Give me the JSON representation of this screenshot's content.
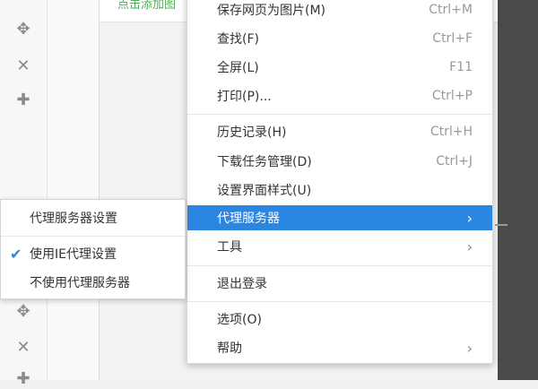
{
  "background_text": "点击添加图",
  "rail_icons_top": [
    "move-icon",
    "close-icon",
    "plus-icon"
  ],
  "rail_icons_bottom": [
    "move-icon",
    "close-icon",
    "plus-icon"
  ],
  "menu": {
    "items": [
      {
        "label": "保存网页为图片(M)",
        "shortcut": "Ctrl+M"
      },
      {
        "label": "查找(F)",
        "shortcut": "Ctrl+F"
      },
      {
        "label": "全屏(L)",
        "shortcut": "F11"
      },
      {
        "label": "打印(P)...",
        "shortcut": "Ctrl+P"
      },
      {
        "label": "历史记录(H)",
        "shortcut": "Ctrl+H"
      },
      {
        "label": "下载任务管理(D)",
        "shortcut": "Ctrl+J"
      },
      {
        "label": "设置界面样式(U)",
        "shortcut": ""
      },
      {
        "label": "代理服务器",
        "shortcut": "",
        "submenu": true,
        "active": true
      },
      {
        "label": "工具",
        "shortcut": "",
        "submenu": true
      },
      {
        "label": "退出登录",
        "shortcut": ""
      },
      {
        "label": "选项(O)",
        "shortcut": ""
      },
      {
        "label": "帮助",
        "shortcut": "",
        "submenu": true
      }
    ],
    "accent_color": "#2b86e2"
  },
  "proxy_submenu": {
    "items": [
      {
        "label": "代理服务器设置",
        "checked": false
      },
      {
        "label": "使用IE代理设置",
        "checked": true
      },
      {
        "label": "不使用代理服务器",
        "checked": false
      }
    ]
  }
}
